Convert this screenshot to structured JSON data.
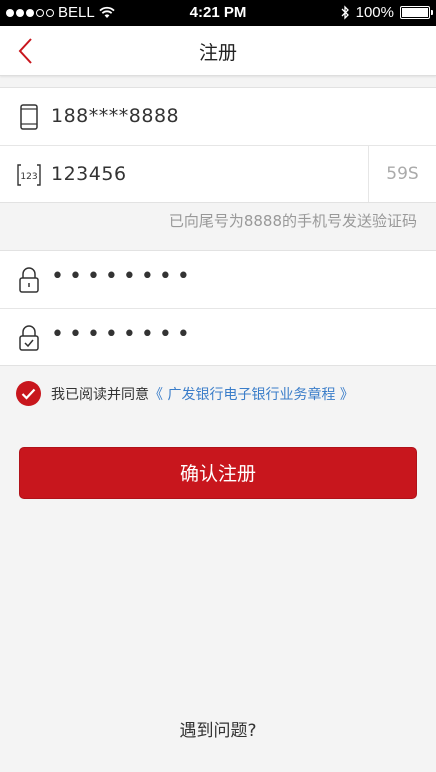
{
  "status": {
    "carrier": "BELL",
    "time": "4:21 PM",
    "battery": "100%"
  },
  "nav": {
    "title": "注册"
  },
  "form": {
    "phone": "188****8888",
    "code": "123456",
    "countdown": "59S",
    "hint": "已向尾号为8888的手机号发送验证码",
    "password": "••••••••",
    "confirm_password": "••••••••"
  },
  "agreement": {
    "prefix": "我已阅读并同意",
    "link": "《 广发银行电子银行业务章程 》"
  },
  "submit_label": "确认注册",
  "help_label": "遇到问题?",
  "colors": {
    "accent": "#c8161d",
    "link": "#3a7dc9"
  }
}
